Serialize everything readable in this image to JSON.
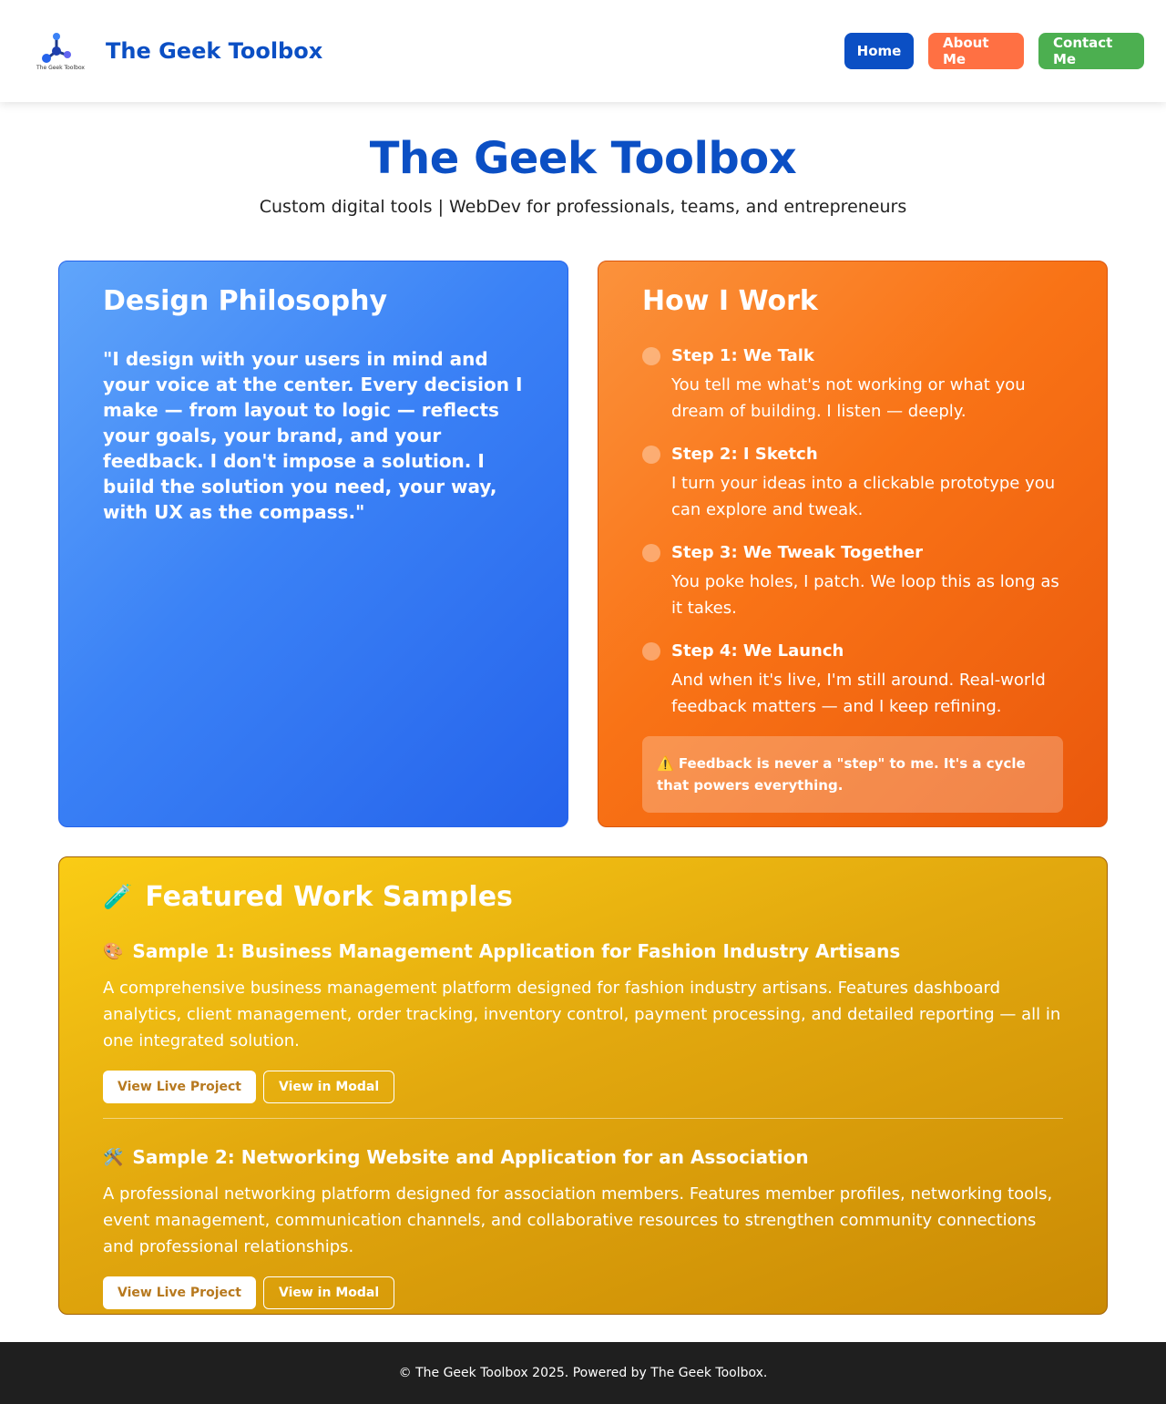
{
  "header": {
    "logo_caption": "The Geek Toolbox",
    "brand": "The Geek Toolbox",
    "nav": {
      "home": "Home",
      "about": "About Me",
      "contact": "Contact Me"
    }
  },
  "hero": {
    "title": "The Geek Toolbox",
    "subtitle": "Custom digital tools | WebDev for professionals, teams, and entrepreneurs"
  },
  "philosophy": {
    "title": "Design Philosophy",
    "quote": "\"I design with your users in mind and your voice at the center. Every decision I make — from layout to logic — reflects your goals, your brand, and your feedback. I don't impose a solution. I build the solution you need, your way, with UX as the compass.\""
  },
  "how": {
    "title": "How I Work",
    "steps": [
      {
        "title": "Step 1: We Talk",
        "desc": "You tell me what's not working or what you dream of building. I listen — deeply."
      },
      {
        "title": "Step 2: I Sketch",
        "desc": "I turn your ideas into a clickable prototype you can explore and tweak."
      },
      {
        "title": "Step 3: We Tweak Together",
        "desc": "You poke holes, I patch. We loop this as long as it takes."
      },
      {
        "title": "Step 4: We Launch",
        "desc": "And when it's live, I'm still around. Real-world feedback matters — and I keep refining."
      }
    ],
    "note_icon": "⚠️",
    "note": "Feedback is never a \"step\" to me. It's a cycle that powers everything."
  },
  "featured": {
    "icon": "🧪",
    "title": "Featured Work Samples",
    "samples": [
      {
        "icon": "🎨",
        "title": "Sample 1: Business Management Application for Fashion Industry Artisans",
        "desc": "A comprehensive business management platform designed for fashion industry artisans. Features dashboard analytics, client management, order tracking, inventory control, payment processing, and detailed reporting — all in one integrated solution.",
        "live": "View Live Project",
        "modal": "View in Modal"
      },
      {
        "icon": "🛠️",
        "title": "Sample 2: Networking Website and Application for an Association",
        "desc": "A professional networking platform designed for association members. Features member profiles, networking tools, event management, communication channels, and collaborative resources to strengthen community connections and professional relationships.",
        "live": "View Live Project",
        "modal": "View in Modal"
      }
    ]
  },
  "footer": {
    "text": "© The Geek Toolbox 2025. Powered by The Geek Toolbox."
  },
  "colors": {
    "brand_blue": "#0b4fc4",
    "about_orange": "#ff7043",
    "contact_green": "#4caf50",
    "footer_bg": "#1f1f1f"
  }
}
